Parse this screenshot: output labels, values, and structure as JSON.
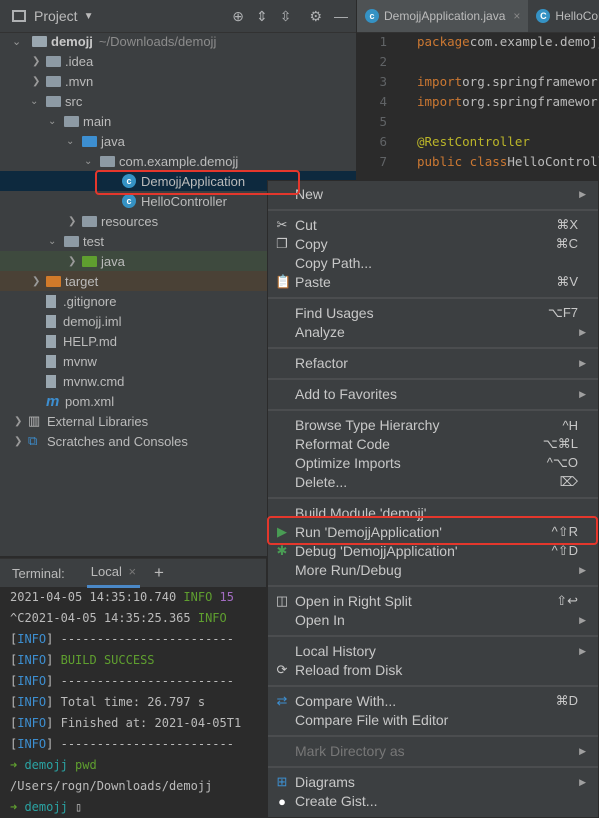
{
  "project": {
    "title": "Project",
    "root": "demojj",
    "root_path": "~/Downloads/demojj",
    "tree": [
      {
        "label": ".idea",
        "depth": 1,
        "chev": "›",
        "kind": "folder"
      },
      {
        "label": ".mvn",
        "depth": 1,
        "chev": "›",
        "kind": "folder"
      },
      {
        "label": "src",
        "depth": 1,
        "chev": "⌄",
        "kind": "folder"
      },
      {
        "label": "main",
        "depth": 2,
        "chev": "⌄",
        "kind": "folder"
      },
      {
        "label": "java",
        "depth": 3,
        "chev": "⌄",
        "kind": "src-folder"
      },
      {
        "label": "com.example.demojj",
        "depth": 4,
        "chev": "⌄",
        "kind": "package"
      },
      {
        "label": "DemojjApplication",
        "depth": 5,
        "chev": "",
        "kind": "class",
        "selected": true
      },
      {
        "label": "HelloController",
        "depth": 5,
        "chev": "",
        "kind": "class"
      },
      {
        "label": "resources",
        "depth": 3,
        "chev": "›",
        "kind": "folder"
      },
      {
        "label": "test",
        "depth": 2,
        "chev": "⌄",
        "kind": "folder"
      },
      {
        "label": "java",
        "depth": 3,
        "chev": "›",
        "kind": "test-folder"
      },
      {
        "label": "target",
        "depth": 1,
        "chev": "›",
        "kind": "excluded-folder"
      },
      {
        "label": ".gitignore",
        "depth": 1,
        "chev": "",
        "kind": "file"
      },
      {
        "label": "demojj.iml",
        "depth": 1,
        "chev": "",
        "kind": "file"
      },
      {
        "label": "HELP.md",
        "depth": 1,
        "chev": "",
        "kind": "md-file"
      },
      {
        "label": "mvnw",
        "depth": 1,
        "chev": "",
        "kind": "script-file"
      },
      {
        "label": "mvnw.cmd",
        "depth": 1,
        "chev": "",
        "kind": "file"
      },
      {
        "label": "pom.xml",
        "depth": 1,
        "chev": "",
        "kind": "maven-file"
      },
      {
        "label": "External Libraries",
        "depth": 0,
        "chev": "›",
        "kind": "libraries"
      },
      {
        "label": "Scratches and Consoles",
        "depth": 0,
        "chev": "›",
        "kind": "scratches"
      }
    ]
  },
  "editor": {
    "tabs": [
      "DemojjApplication.java",
      "HelloController"
    ],
    "lines": [
      {
        "n": "1",
        "parts": [
          [
            "kw",
            "package "
          ],
          [
            "",
            "com.example.demojj;"
          ]
        ]
      },
      {
        "n": "2",
        "parts": []
      },
      {
        "n": "3",
        "parts": [
          [
            "kw",
            "import "
          ],
          [
            "",
            "org.springframework"
          ]
        ]
      },
      {
        "n": "4",
        "parts": [
          [
            "kw",
            "import "
          ],
          [
            "",
            "org.springframework"
          ]
        ]
      },
      {
        "n": "5",
        "parts": []
      },
      {
        "n": "6",
        "parts": [
          [
            "ann",
            "@RestController"
          ]
        ]
      },
      {
        "n": "7",
        "parts": [
          [
            "kw",
            "public class "
          ],
          [
            "",
            "HelloController"
          ]
        ]
      }
    ]
  },
  "terminal": {
    "label": "Terminal:",
    "tab": "Local",
    "lines": [
      [
        [
          "",
          "2021-04-05 14:35:10.740  "
        ],
        [
          "gr",
          "INFO "
        ],
        [
          "pu",
          "15"
        ]
      ],
      [
        [
          "",
          "^C2021-04-05 14:35:25.365  "
        ],
        [
          "gr",
          "INFO"
        ]
      ],
      [
        [
          "",
          "["
        ],
        [
          "bl",
          "INFO"
        ],
        [
          "",
          "] ------------------------"
        ]
      ],
      [
        [
          "",
          "["
        ],
        [
          "bl",
          "INFO"
        ],
        [
          "",
          "] "
        ],
        [
          "gr",
          "BUILD SUCCESS"
        ]
      ],
      [
        [
          "",
          "["
        ],
        [
          "bl",
          "INFO"
        ],
        [
          "",
          "] ------------------------"
        ]
      ],
      [
        [
          "",
          "["
        ],
        [
          "bl",
          "INFO"
        ],
        [
          "",
          "] Total time:  26.797 s"
        ]
      ],
      [
        [
          "",
          "["
        ],
        [
          "bl",
          "INFO"
        ],
        [
          "",
          "] Finished at: 2021-04-05T1"
        ]
      ],
      [
        [
          "",
          "["
        ],
        [
          "bl",
          "INFO"
        ],
        [
          "",
          "] ------------------------"
        ]
      ],
      [
        [
          "gr",
          "➜  "
        ],
        [
          "cy",
          "demojj "
        ],
        [
          "gr",
          "pwd"
        ]
      ],
      [
        [
          "",
          "/Users/rogn/Downloads/demojj"
        ]
      ],
      [
        [
          "gr",
          "➜  "
        ],
        [
          "cy",
          "demojj "
        ],
        [
          "",
          "▯"
        ]
      ]
    ]
  },
  "menu": [
    [
      {
        "label": "New",
        "sub": true
      }
    ],
    [
      {
        "label": "Cut",
        "sc": "⌘X",
        "icon": "✂",
        "name": "scissors-icon"
      },
      {
        "label": "Copy",
        "sc": "⌘C",
        "icon": "❐",
        "name": "copy-icon"
      },
      {
        "label": "Copy Path..."
      },
      {
        "label": "Paste",
        "sc": "⌘V",
        "icon": "📋",
        "name": "clipboard-icon"
      }
    ],
    [
      {
        "label": "Find Usages",
        "sc": "⌥F7"
      },
      {
        "label": "Analyze",
        "sub": true
      }
    ],
    [
      {
        "label": "Refactor",
        "sub": true
      }
    ],
    [
      {
        "label": "Add to Favorites",
        "sub": true
      }
    ],
    [
      {
        "label": "Browse Type Hierarchy",
        "sc": "^H"
      },
      {
        "label": "Reformat Code",
        "sc": "⌥⌘L"
      },
      {
        "label": "Optimize Imports",
        "sc": "^⌥O"
      },
      {
        "label": "Delete...",
        "sc": "⌦"
      }
    ],
    [
      {
        "label": "Build Module 'demojj'"
      },
      {
        "label": "Run 'DemojjApplication'",
        "sc": "^⇧R",
        "icon": "▶",
        "name": "run-icon",
        "color": "#499c54"
      },
      {
        "label": "Debug 'DemojjApplication'",
        "sc": "^⇧D",
        "icon": "✱",
        "name": "debug-icon",
        "color": "#499c54"
      },
      {
        "label": "More Run/Debug",
        "sub": true
      }
    ],
    [
      {
        "label": "Open in Right Split",
        "sc": "⇧↩",
        "icon": "◫",
        "name": "split-icon"
      },
      {
        "label": "Open In",
        "sub": true
      }
    ],
    [
      {
        "label": "Local History",
        "sub": true
      },
      {
        "label": "Reload from Disk",
        "icon": "⟳",
        "name": "reload-icon"
      }
    ],
    [
      {
        "label": "Compare With...",
        "sc": "⌘D",
        "icon": "⇄",
        "name": "compare-icon",
        "color": "#3d8fd1"
      },
      {
        "label": "Compare File with Editor"
      }
    ],
    [
      {
        "label": "Mark Directory as",
        "sub": true,
        "disabled": true
      }
    ],
    [
      {
        "label": "Diagrams",
        "sub": true,
        "icon": "⊞",
        "name": "diagram-icon",
        "color": "#3d8fd1"
      },
      {
        "label": "Create Gist...",
        "icon": "●",
        "name": "github-icon",
        "color": "#ffffff"
      }
    ]
  ],
  "colors": {
    "highlight": "#e4372c",
    "selection": "#0d293e",
    "accent": "#3592c4"
  }
}
